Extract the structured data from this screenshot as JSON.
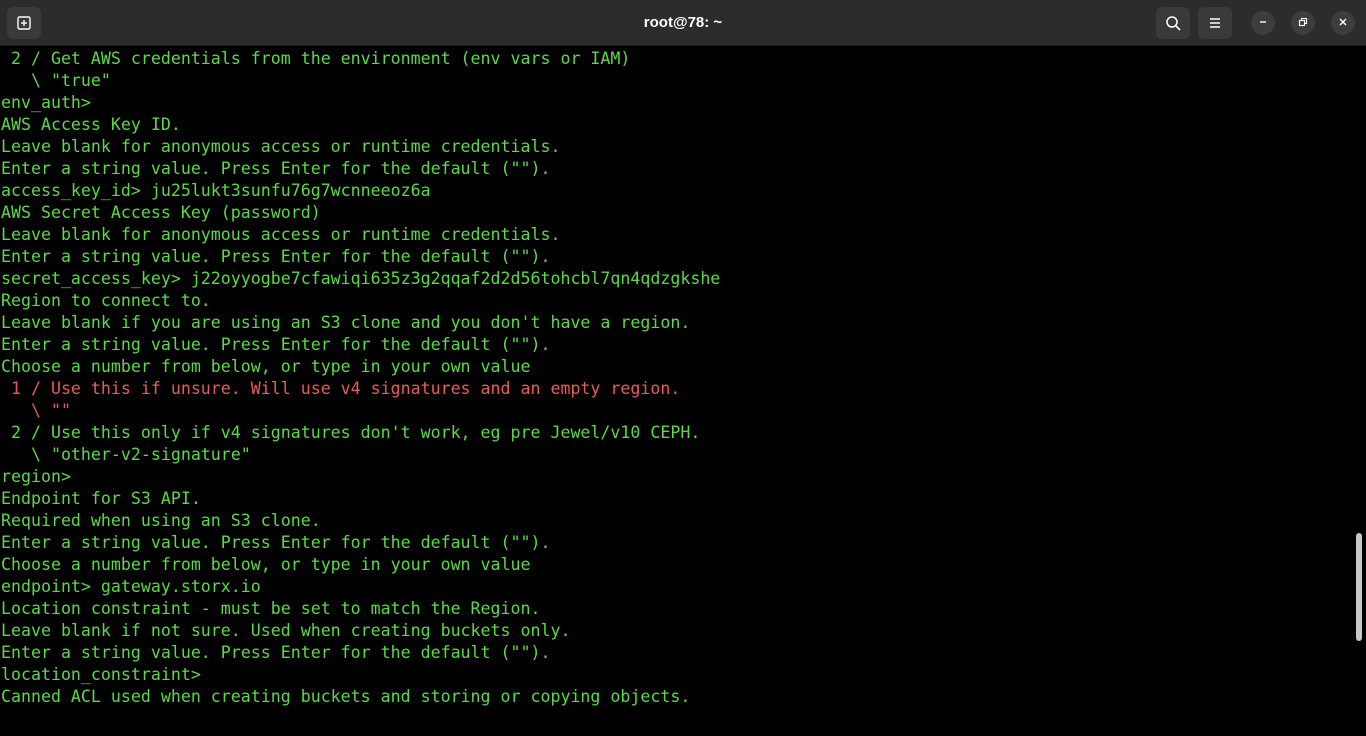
{
  "window": {
    "title": "root@78: ~"
  },
  "header_buttons": {
    "new_tab_icon": "new-tab-icon",
    "search_icon": "search-icon",
    "menu_icon": "hamburger-menu-icon",
    "minimize_icon": "minimize-icon",
    "maximize_icon": "maximize-icon",
    "close_icon": "close-icon"
  },
  "colors": {
    "background": "#000000",
    "output_green": "#5dd84a",
    "highlight_red": "#e35d5d",
    "titlebar": "#2c2c2c"
  },
  "terminal": {
    "lines": [
      {
        "text": " 2 / Get AWS credentials from the environment (env vars or IAM)",
        "color": "green"
      },
      {
        "text": "   \\ \"true\"",
        "color": "green"
      },
      {
        "text": "env_auth>",
        "color": "green"
      },
      {
        "text": "AWS Access Key ID.",
        "color": "green"
      },
      {
        "text": "Leave blank for anonymous access or runtime credentials.",
        "color": "green"
      },
      {
        "text": "Enter a string value. Press Enter for the default (\"\").",
        "color": "green"
      },
      {
        "text": "access_key_id> ju25lukt3sunfu76g7wcnneeoz6a",
        "color": "green"
      },
      {
        "text": "AWS Secret Access Key (password)",
        "color": "green"
      },
      {
        "text": "Leave blank for anonymous access or runtime credentials.",
        "color": "green"
      },
      {
        "text": "Enter a string value. Press Enter for the default (\"\").",
        "color": "green"
      },
      {
        "text": "secret_access_key> j22oyyogbe7cfawiqi635z3g2qqaf2d2d56tohcbl7qn4qdzgkshe",
        "color": "green"
      },
      {
        "text": "Region to connect to.",
        "color": "green"
      },
      {
        "text": "Leave blank if you are using an S3 clone and you don't have a region.",
        "color": "green"
      },
      {
        "text": "Enter a string value. Press Enter for the default (\"\").",
        "color": "green"
      },
      {
        "text": "Choose a number from below, or type in your own value",
        "color": "green"
      },
      {
        "text": " 1 / Use this if unsure. Will use v4 signatures and an empty region.",
        "color": "red"
      },
      {
        "text": "   \\ \"\"",
        "color": "red"
      },
      {
        "text": " 2 / Use this only if v4 signatures don't work, eg pre Jewel/v10 CEPH.",
        "color": "green"
      },
      {
        "text": "   \\ \"other-v2-signature\"",
        "color": "green"
      },
      {
        "text": "region>",
        "color": "green"
      },
      {
        "text": "Endpoint for S3 API.",
        "color": "green"
      },
      {
        "text": "Required when using an S3 clone.",
        "color": "green"
      },
      {
        "text": "Enter a string value. Press Enter for the default (\"\").",
        "color": "green"
      },
      {
        "text": "Choose a number from below, or type in your own value",
        "color": "green"
      },
      {
        "text": "endpoint> gateway.storx.io",
        "color": "green"
      },
      {
        "text": "Location constraint - must be set to match the Region.",
        "color": "green"
      },
      {
        "text": "Leave blank if not sure. Used when creating buckets only.",
        "color": "green"
      },
      {
        "text": "Enter a string value. Press Enter for the default (\"\").",
        "color": "green"
      },
      {
        "text": "location_constraint>",
        "color": "green"
      },
      {
        "text": "Canned ACL used when creating buckets and storing or copying objects.",
        "color": "green"
      }
    ]
  }
}
